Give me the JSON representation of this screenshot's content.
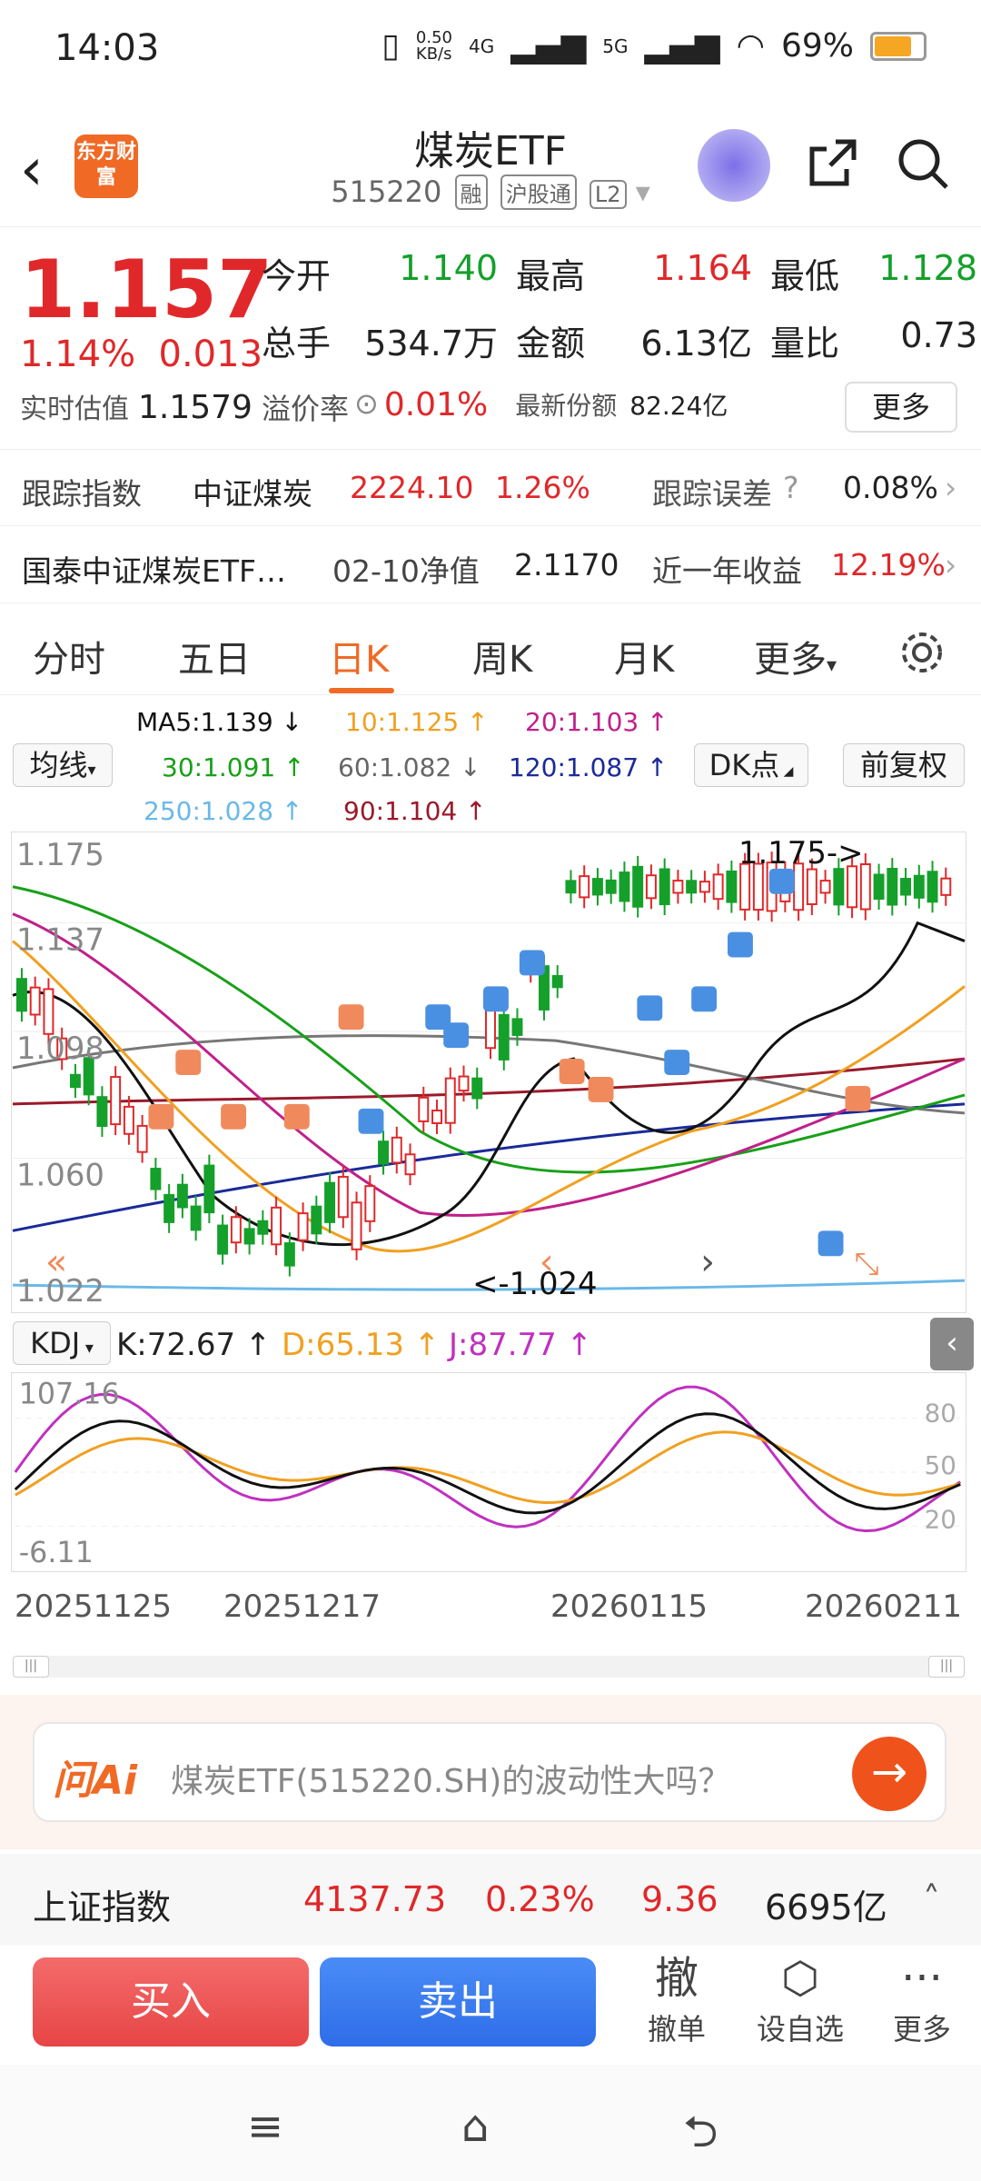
{
  "status": {
    "time": "14:03",
    "speed": "0.50\nKB/s",
    "net1": "4G",
    "net2": "5G",
    "battery": "69%"
  },
  "header": {
    "logo": "东方财富",
    "title": "煤炭ETF",
    "code": "515220",
    "tags": [
      "融",
      "沪股通",
      "L2"
    ]
  },
  "quote": {
    "price": "1.157",
    "pct": "1.14%",
    "chg": "0.013",
    "open_label": "今开",
    "open": "1.140",
    "high_label": "最高",
    "high": "1.164",
    "low_label": "最低",
    "low": "1.128",
    "vol_label": "总手",
    "vol": "534.7万",
    "amt_label": "金额",
    "amt": "6.13亿",
    "ratio_label": "量比",
    "ratio": "0.73",
    "est_label": "实时估值",
    "est": "1.1579",
    "prem_label": "溢价率",
    "prem": "0.01%",
    "shares_label": "最新份额",
    "shares": "82.24亿",
    "more": "更多"
  },
  "tracking": {
    "index_label": "跟踪指数",
    "index_name": "中证煤炭",
    "index_val": "2224.10",
    "index_pct": "1.26%",
    "err_label": "跟踪误差",
    "err_val": "0.08%",
    "fund_name": "国泰中证煤炭ETF…",
    "nav_label": "02-10净值",
    "nav_val": "2.1170",
    "ret_label": "近一年收益",
    "ret_val": "12.19%"
  },
  "tabs": [
    "分时",
    "五日",
    "日K",
    "周K",
    "月K",
    "更多"
  ],
  "ma": {
    "selector": "均线",
    "ma5": "MA5:1.139 ↓",
    "ma10": "10:1.125 ↑",
    "ma20": "20:1.103 ↑",
    "ma30": "30:1.091 ↑",
    "ma60": "60:1.082 ↓",
    "ma120": "120:1.087 ↑",
    "ma250": "250:1.028 ↑",
    "ma90": "90:1.104 ↑",
    "dk": "DK点",
    "fq": "前复权"
  },
  "chart": {
    "y_labels": [
      "1.175",
      "1.137",
      "1.098",
      "1.060",
      "1.022"
    ],
    "max_note": "1.175->",
    "min_note": "<-1.024",
    "colors": {
      "up": "#e0282a",
      "down": "#14a02a",
      "ma5": "#111111",
      "ma10": "#f0a020",
      "ma20": "#c0208a",
      "ma30": "#18a018",
      "ma60": "#777777",
      "ma120": "#1a2a9a",
      "ma250": "#6ab8e8",
      "ma90": "#9a1a2a"
    }
  },
  "kdj": {
    "selector": "KDJ",
    "k": "K:72.67 ↑",
    "d": "D:65.13 ↑",
    "j": "J:87.77 ↑",
    "top": "107.16",
    "bottom": "-6.11",
    "lv80": "80",
    "lv50": "50",
    "lv20": "20"
  },
  "dates": [
    "20251125",
    "20251217",
    "20260115",
    "20260211"
  ],
  "ai": {
    "logo": "问Ai",
    "question": "煤炭ETF(515220.SH)的波动性大吗？"
  },
  "index_bar": {
    "name": "上证指数",
    "val": "4137.73",
    "pct": "0.23%",
    "chg": "9.36",
    "amt": "6695亿"
  },
  "trade": {
    "buy": "买入",
    "sell": "卖出",
    "cancel_icon": "撤",
    "cancel": "撤单",
    "fav": "设自选",
    "more": "更多"
  }
}
